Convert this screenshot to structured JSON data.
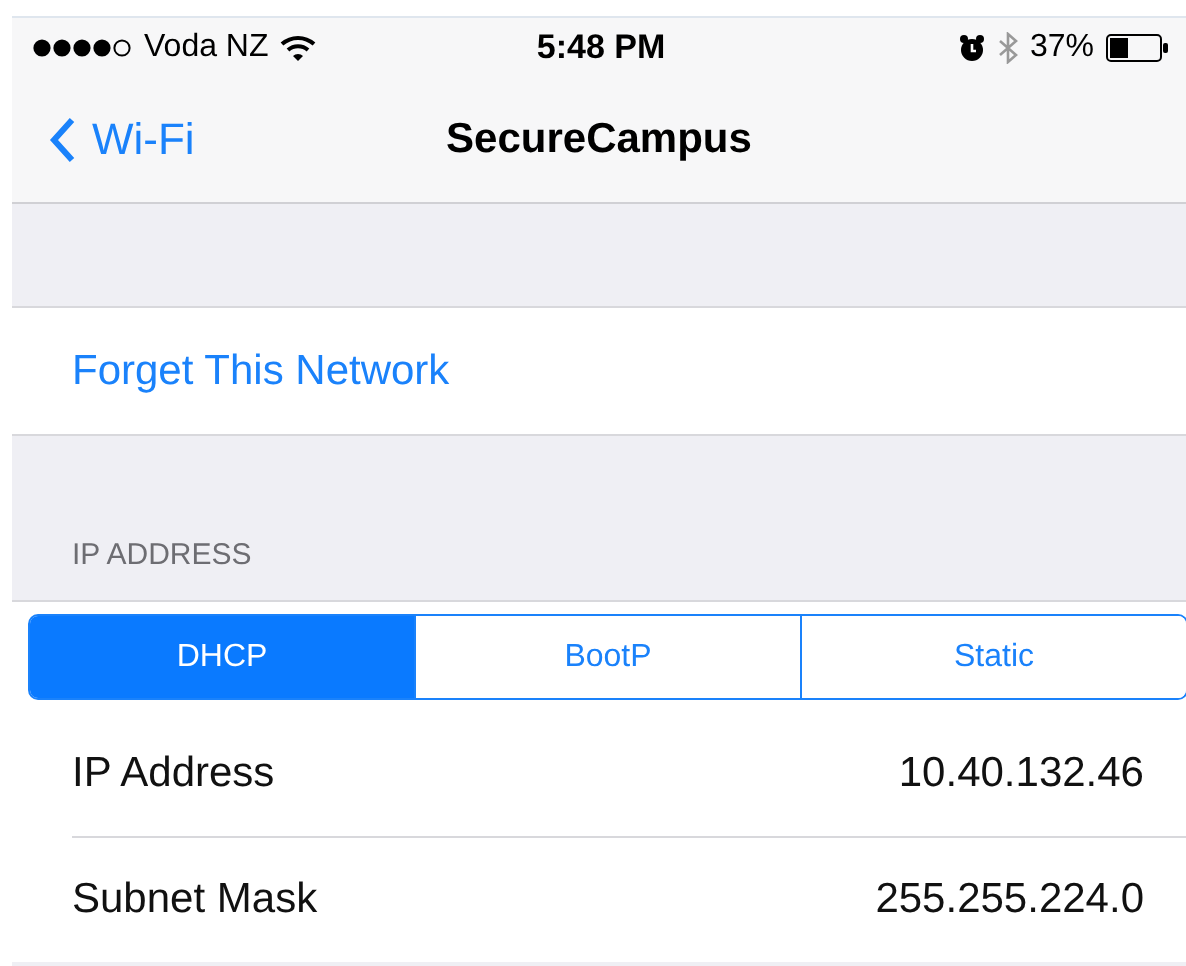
{
  "status_bar": {
    "carrier": "Voda NZ",
    "time": "5:48 PM",
    "battery": "37%"
  },
  "nav_bar": {
    "back": "Wi-Fi",
    "title": "SecureCampus"
  },
  "forget_button": "Forget This Network",
  "section_header": "IP ADDRESS",
  "segments": [
    {
      "label": "DHCP",
      "selected": true
    },
    {
      "label": "BootP",
      "selected": false
    },
    {
      "label": "Static",
      "selected": false
    }
  ],
  "rows": [
    {
      "label": "IP Address",
      "value": "10.40.132.46"
    },
    {
      "label": "Subnet Mask",
      "value": "255.255.224.0"
    }
  ]
}
